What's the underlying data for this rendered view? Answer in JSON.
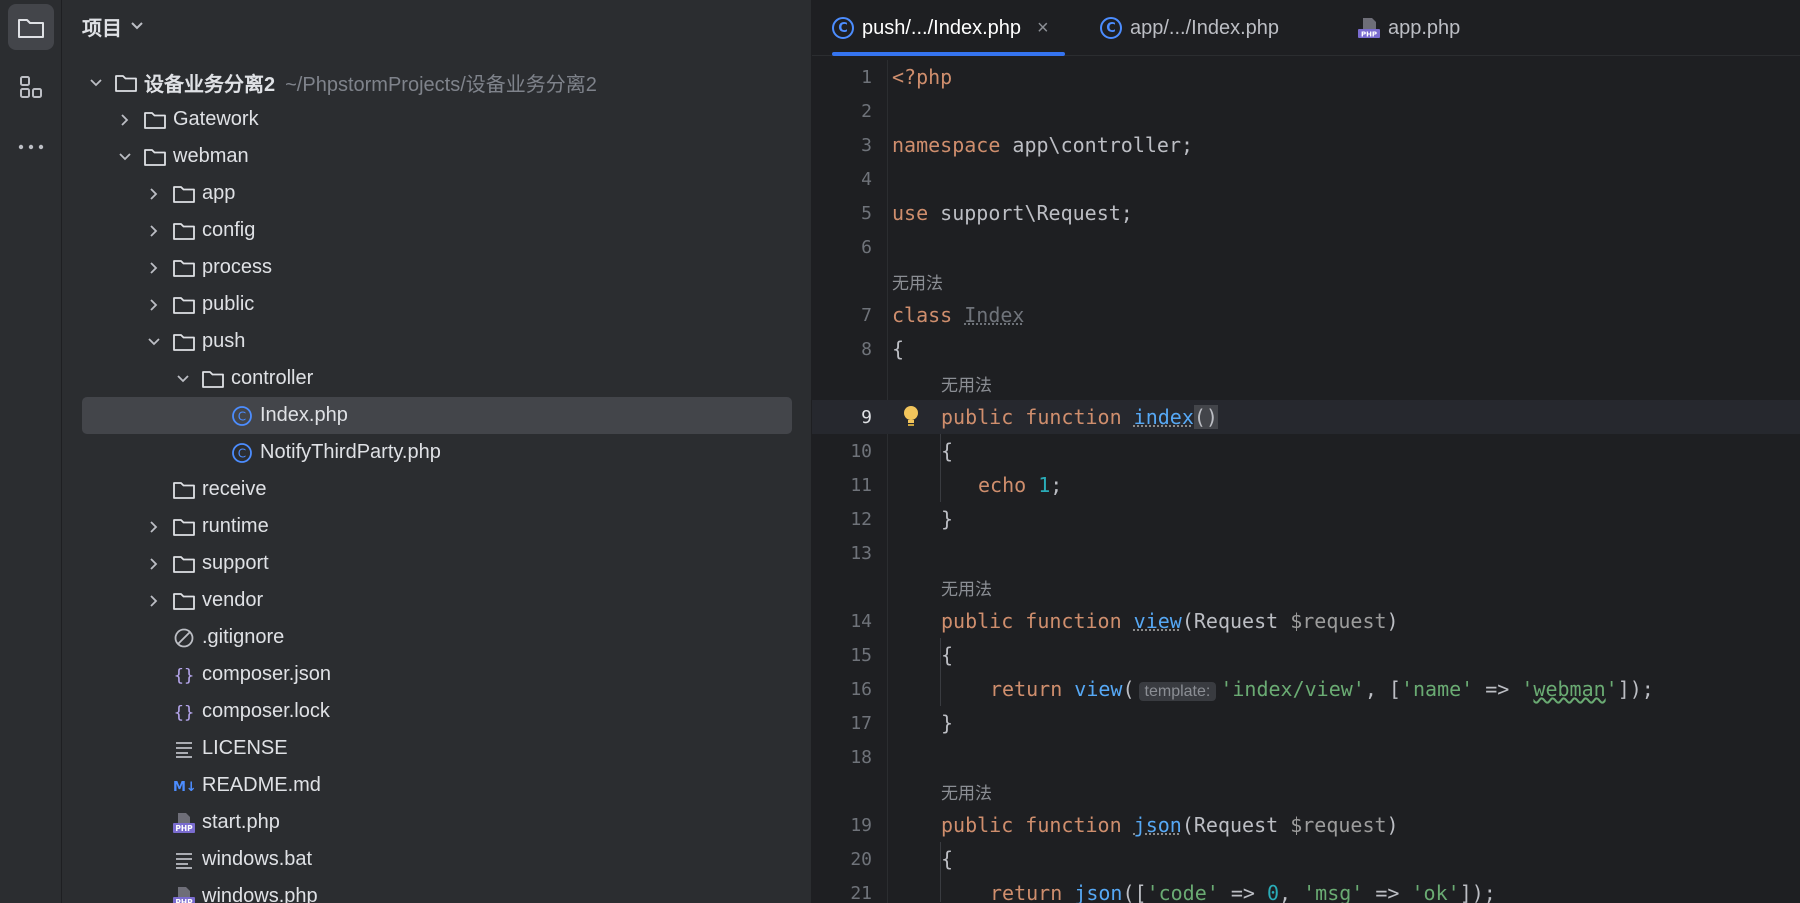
{
  "sidebar": {
    "icons": [
      "folder-icon",
      "structure-icon",
      "more-icon"
    ]
  },
  "project": {
    "header_label": "项目",
    "tree": [
      {
        "label": "设备业务分离2",
        "path": "~/PhpstormProjects/设备业务分离2",
        "depth": 0,
        "expanded": true,
        "icon": "folder"
      },
      {
        "label": "Gatework",
        "depth": 1,
        "expanded": false,
        "icon": "folder"
      },
      {
        "label": "webman",
        "depth": 1,
        "expanded": true,
        "icon": "folder"
      },
      {
        "label": "app",
        "depth": 2,
        "expanded": false,
        "icon": "folder"
      },
      {
        "label": "config",
        "depth": 2,
        "expanded": false,
        "icon": "folder"
      },
      {
        "label": "process",
        "depth": 2,
        "expanded": false,
        "icon": "folder"
      },
      {
        "label": "public",
        "depth": 2,
        "expanded": false,
        "icon": "folder"
      },
      {
        "label": "push",
        "depth": 2,
        "expanded": true,
        "icon": "folder"
      },
      {
        "label": "controller",
        "depth": 3,
        "expanded": true,
        "icon": "folder"
      },
      {
        "label": "Index.php",
        "depth": 4,
        "icon": "class",
        "selected": true
      },
      {
        "label": "NotifyThirdParty.php",
        "depth": 4,
        "icon": "class"
      },
      {
        "label": "receive",
        "depth": 2,
        "icon": "folder",
        "leafFolder": true
      },
      {
        "label": "runtime",
        "depth": 2,
        "expanded": false,
        "icon": "folder"
      },
      {
        "label": "support",
        "depth": 2,
        "expanded": false,
        "icon": "folder"
      },
      {
        "label": "vendor",
        "depth": 2,
        "expanded": false,
        "icon": "folder"
      },
      {
        "label": ".gitignore",
        "depth": 2,
        "icon": "ignore",
        "leaf": true
      },
      {
        "label": "composer.json",
        "depth": 2,
        "icon": "json",
        "leaf": true
      },
      {
        "label": "composer.lock",
        "depth": 2,
        "icon": "json",
        "leaf": true
      },
      {
        "label": "LICENSE",
        "depth": 2,
        "icon": "text",
        "leaf": true
      },
      {
        "label": "README.md",
        "depth": 2,
        "icon": "markdown",
        "leaf": true
      },
      {
        "label": "start.php",
        "depth": 2,
        "icon": "php",
        "leaf": true
      },
      {
        "label": "windows.bat",
        "depth": 2,
        "icon": "text",
        "leaf": true
      },
      {
        "label": "windows.php",
        "depth": 2,
        "icon": "php",
        "leaf": true
      }
    ]
  },
  "tabs": [
    {
      "label": "push/.../Index.php",
      "icon": "class",
      "active": true
    },
    {
      "label": "app/.../Index.php",
      "icon": "class",
      "active": false
    },
    {
      "label": "app.php",
      "icon": "php",
      "active": false
    }
  ],
  "editor": {
    "unused_hint": "无用法",
    "inlay_template": "template:",
    "lines": [
      {
        "n": "1"
      },
      {
        "n": "2"
      },
      {
        "n": "3"
      },
      {
        "n": "4"
      },
      {
        "n": "5"
      },
      {
        "n": "6"
      },
      {
        "n": "7"
      },
      {
        "n": "8"
      },
      {
        "n": "9"
      },
      {
        "n": "10"
      },
      {
        "n": "11"
      },
      {
        "n": "12"
      },
      {
        "n": "13"
      },
      {
        "n": "14"
      },
      {
        "n": "15"
      },
      {
        "n": "16"
      },
      {
        "n": "17"
      },
      {
        "n": "18"
      },
      {
        "n": "19"
      },
      {
        "n": "20"
      },
      {
        "n": "21"
      }
    ],
    "current_line": "9"
  },
  "colors": {
    "accent": "#3574f0",
    "keyword": "#cf8e6d",
    "function": "#56a8f5",
    "string": "#6aab73",
    "number": "#2aacb8"
  }
}
